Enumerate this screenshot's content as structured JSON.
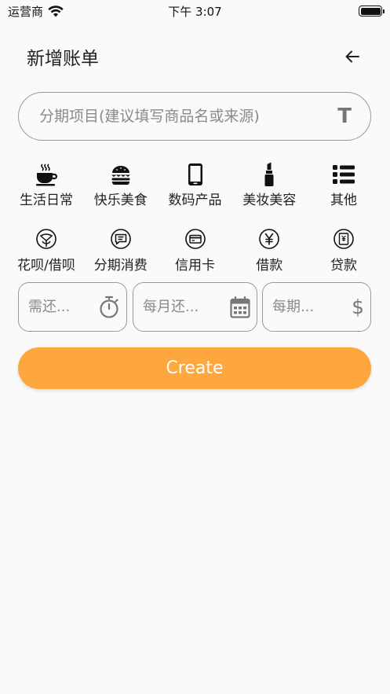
{
  "status_bar": {
    "carrier": "运营商",
    "time": "下午 3:07"
  },
  "header": {
    "title": "新增账单",
    "back_icon": "arrow-left-icon"
  },
  "project_input": {
    "placeholder": "分期项目(建议填写商品名或来源)",
    "value": "",
    "icon": "text-format-icon",
    "icon_glyph": "T"
  },
  "categories": [
    {
      "label": "生活日常",
      "icon": "coffee-cup-icon"
    },
    {
      "label": "快乐美食",
      "icon": "burger-icon"
    },
    {
      "label": "数码产品",
      "icon": "smartphone-icon"
    },
    {
      "label": "美妆美容",
      "icon": "lipstick-icon"
    },
    {
      "label": "其他",
      "icon": "list-icon"
    }
  ],
  "payment_types": [
    {
      "label": "花呗/借呗",
      "icon": "huabei-icon"
    },
    {
      "label": "分期消费",
      "icon": "installment-icon"
    },
    {
      "label": "信用卡",
      "icon": "credit-card-icon"
    },
    {
      "label": "借款",
      "icon": "yuan-coin-icon"
    },
    {
      "label": "贷款",
      "icon": "loan-icon"
    }
  ],
  "fields": {
    "repay_total": {
      "placeholder": "需还...",
      "value": "",
      "icon": "timer-icon"
    },
    "monthly_date": {
      "placeholder": "每月还...",
      "value": "",
      "icon": "calendar-icon"
    },
    "per_period": {
      "placeholder": "每期...",
      "value": "",
      "icon": "dollar-icon",
      "icon_glyph": "$"
    }
  },
  "create_button": {
    "label": "Create"
  },
  "colors": {
    "accent": "#fea73f",
    "border": "#9a9a9a",
    "placeholder": "#8a8a8a",
    "background": "#fafafa"
  }
}
